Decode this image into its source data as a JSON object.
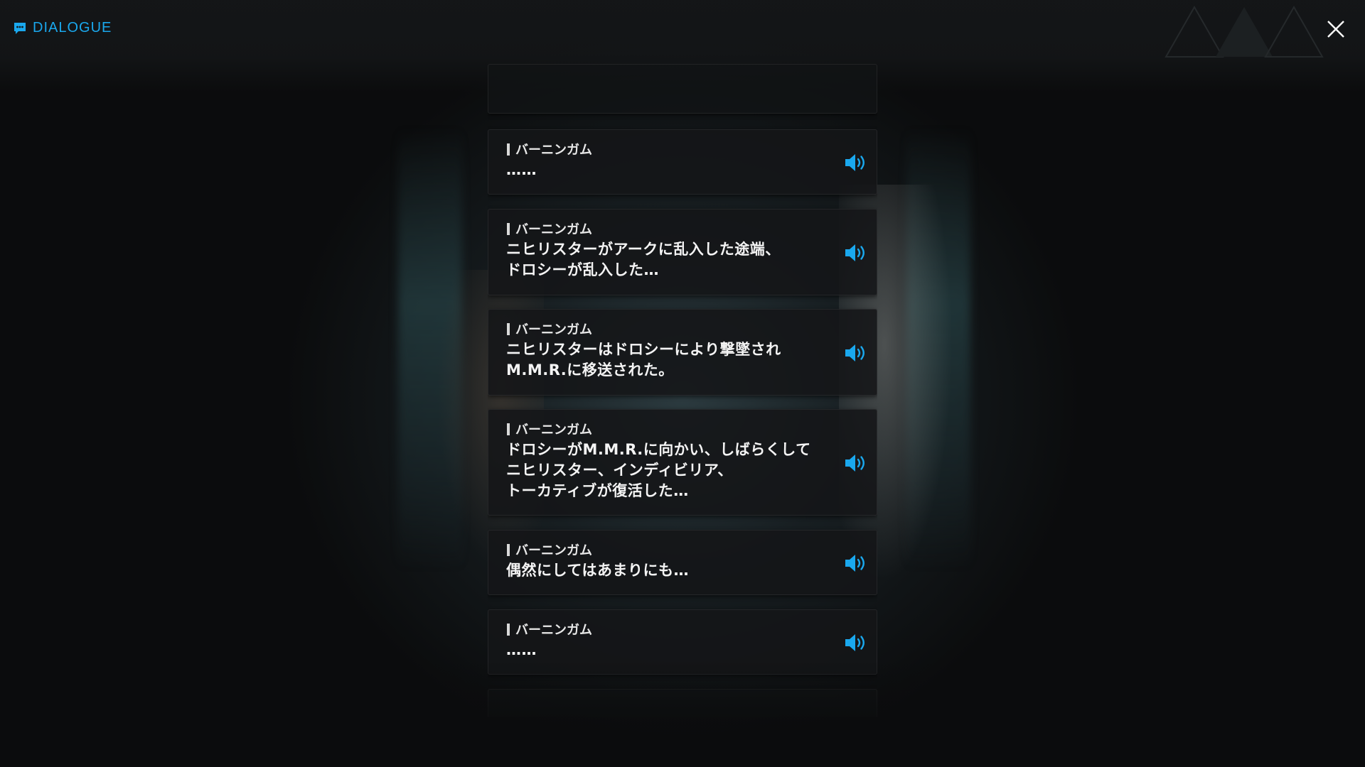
{
  "header": {
    "title": "DIALOGUE",
    "icon": "chat-bubble-icon",
    "accent_color": "#1aa8ee"
  },
  "close": {
    "icon": "close-icon"
  },
  "dialogue": [
    {
      "speaker": "バーニンガム",
      "text": "……"
    },
    {
      "speaker": "バーニンガム",
      "text": "ニヒリスターがアークに乱入した途端、\nドロシーが乱入した…"
    },
    {
      "speaker": "バーニンガム",
      "text": "ニヒリスターはドロシーにより撃墜され\nM.M.R.に移送された。"
    },
    {
      "speaker": "バーニンガム",
      "text": "ドロシーがM.M.R.に向かい、しばらくして\nニヒリスター、インディビリア、\nトーカティブが復活した…"
    },
    {
      "speaker": "バーニンガム",
      "text": "偶然にしてはあまりにも…"
    },
    {
      "speaker": "バーニンガム",
      "text": "……"
    }
  ],
  "voice_icon": "speaker-volume-icon"
}
